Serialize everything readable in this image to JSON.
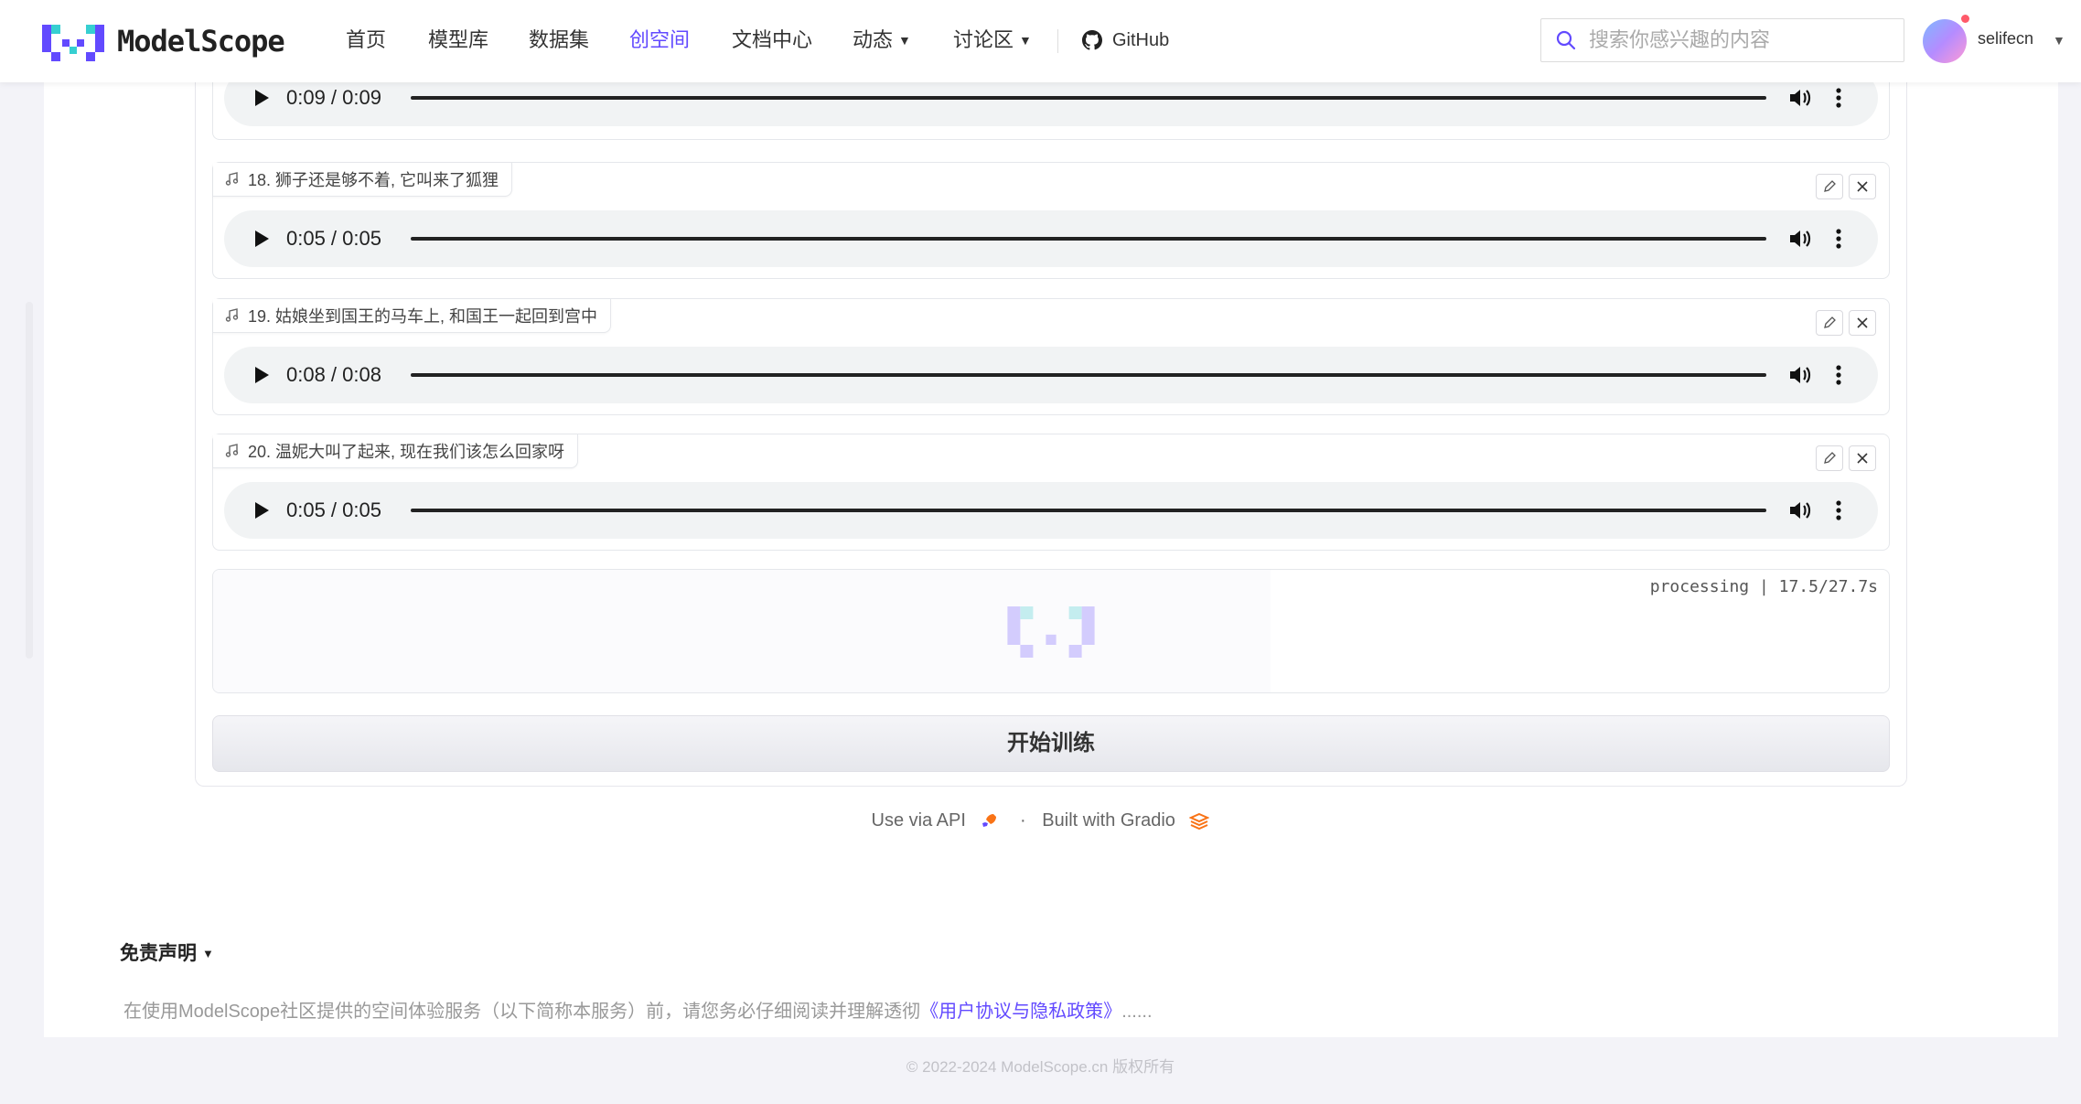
{
  "brand": {
    "name": "ModelScope"
  },
  "nav": {
    "items": [
      {
        "label": "首页"
      },
      {
        "label": "模型库"
      },
      {
        "label": "数据集"
      },
      {
        "label": "创空间",
        "active": true
      },
      {
        "label": "文档中心"
      },
      {
        "label": "动态",
        "caret": "▼"
      },
      {
        "label": "讨论区",
        "caret": "▼"
      }
    ],
    "github": "GitHub"
  },
  "search": {
    "placeholder": "搜索你感兴趣的内容"
  },
  "user": {
    "name": "selifecn",
    "caret": "▼"
  },
  "audio_items": [
    {
      "label": "",
      "time": "0:09 / 0:09"
    },
    {
      "label": "18. 狮子还是够不着, 它叫来了狐狸",
      "time": "0:05 / 0:05"
    },
    {
      "label": "19. 姑娘坐到国王的马车上, 和国王一起回到宫中",
      "time": "0:08 / 0:08"
    },
    {
      "label": "20. 温妮大叫了起来, 现在我们该怎么回家呀",
      "time": "0:05 / 0:05"
    }
  ],
  "processing": {
    "status": "processing | 17.5/27.7s"
  },
  "train_button": "开始训练",
  "footer": {
    "api": "Use via API",
    "dot": "·",
    "built": "Built with Gradio"
  },
  "disclaimer": {
    "title": "免责声明",
    "caret": "▼",
    "text_prefix": "在使用ModelScope社区提供的空间体验服务（以下简称本服务）前，请您务必仔细阅读并理解透彻",
    "link": "《用户协议与隐私政策》",
    "ellipsis": "......"
  },
  "copyright": "© 2022-2024 ModelScope.cn 版权所有",
  "colors": {
    "accent": "#624aff",
    "gradio_orange": "#f97316"
  }
}
